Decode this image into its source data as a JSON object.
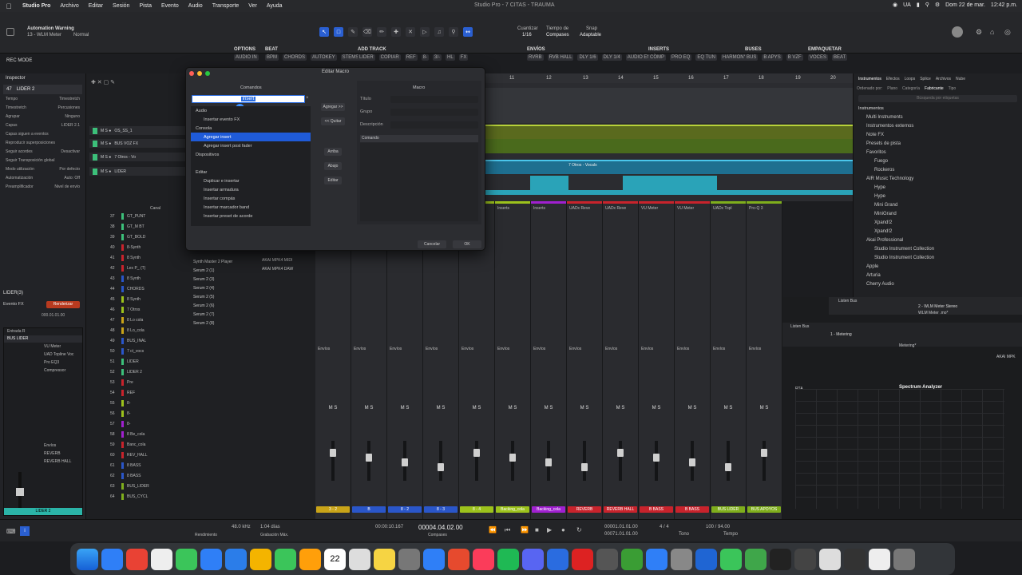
{
  "menubar": {
    "app": "Studio Pro",
    "items": [
      "Archivo",
      "Editar",
      "Sesión",
      "Pista",
      "Evento",
      "Audio",
      "Transporte",
      "Ver",
      "Ayuda"
    ],
    "window_title": "Studio Pro - 7 CITAS - TRAUMA",
    "lang": "UA",
    "date": "Dom 22 de mar.",
    "time": "12:42 p.m."
  },
  "toolbar": {
    "automation_label": "Automation Warning",
    "automation_sub": "13 - WLM Meter",
    "mode": "Normal",
    "rec_mode": "REC MODE",
    "groups": [
      {
        "title": "OPTIONS",
        "items": [
          "AUDIO IN"
        ]
      },
      {
        "title": "BEAT",
        "items": [
          "BPM",
          "CHORDS",
          "AUTOKEY",
          "STEMS"
        ]
      },
      {
        "title": "ADD TRACK",
        "items": [
          "LIDER",
          "COPIAR",
          "REF",
          "8-",
          "3/-",
          "HL",
          "FX"
        ]
      },
      {
        "title": "ENVÍOS",
        "items": [
          "RVRB",
          "RVB HALL",
          "DLY 1/6",
          "DLY 1/4",
          "AUDIO ENVÍO"
        ]
      },
      {
        "title": "INSERTS",
        "items": [
          "COMP",
          "PRO EQ",
          "EQ TUN",
          "HARMONY"
        ]
      },
      {
        "title": "BUSES",
        "items": [
          "BUS",
          "B APYS",
          "B VZF"
        ]
      },
      {
        "title": "EMPAQUETAR",
        "items": [
          "VOCES",
          "BEAT"
        ]
      }
    ],
    "quantize_label": "Cuantizar",
    "quantize_value": "1/16",
    "timebase_label": "Tiempo de",
    "timebase_value": "Compases",
    "snap_label": "Snap",
    "snap_value": "Adaptable"
  },
  "inspector": {
    "title": "Inspector",
    "track_num": "47",
    "track_name": "LIDER 2",
    "tempo_label": "Tempo",
    "tempo_value": "Timestretch",
    "timestretch_label": "Timestretch",
    "timestretch_value": "Percusiones",
    "group_label": "Agrupar",
    "group_value": "Ninguno",
    "layers_label": "Capas",
    "layers_value": "LIDER 2.1",
    "follow_label": "Capas siguen a eventos",
    "overdub_label": "Reproducir superposiciones",
    "chord_label": "Seguir acordes",
    "chord_value": "Desactivar",
    "transposition_label": "Seguir Transposición global",
    "delay_label": "Modo utilización",
    "delay_value": "Por defecto",
    "automation_label": "Automatización",
    "automation_value": "Auto: Off",
    "preamp_label": "Preamplificador",
    "preamp_value": "Nivel de envío",
    "sel_track": "LIDER(3)",
    "event_fx": "Evento FX",
    "render": "Renderizar",
    "pos": "000.01.01.00",
    "strip_label": "Entrada R",
    "bus_label": "BUS LIDER",
    "ins1": "VU Meter",
    "ins2": "UAD Topline Voc",
    "ins3": "Pro EQ3",
    "ins4": "Compressor",
    "send1": "Envíos",
    "send2": "REVERB",
    "send3": "REVERB HALL",
    "strip_name": "LIDER 2"
  },
  "tracks": [
    "OS_SS_1",
    "BUS VOZ FX",
    "7 Otros - Vo",
    "LIDER"
  ],
  "channel_list": {
    "header": "Canal",
    "rows": [
      [
        "37",
        "GT_PUNT"
      ],
      [
        "38",
        "GT_M BT"
      ],
      [
        "39",
        "GT_BOLD"
      ],
      [
        "40",
        "8-Synth"
      ],
      [
        "41",
        "8 Synth"
      ],
      [
        "42",
        "Lex P_ (T)"
      ],
      [
        "43",
        "8 Synth"
      ],
      [
        "44",
        "CHORDS"
      ],
      [
        "45",
        "8 Synth"
      ],
      [
        "46",
        "7 Otros"
      ],
      [
        "47",
        "8 Lo cola"
      ],
      [
        "48",
        "8 Lo_cola"
      ],
      [
        "49",
        "BUS_INAL"
      ],
      [
        "50",
        "7 ct_vocs"
      ],
      [
        "51",
        "LIDER"
      ],
      [
        "52",
        "LIDER 2"
      ],
      [
        "53",
        "Pre"
      ],
      [
        "54",
        "REF"
      ],
      [
        "55",
        "8-"
      ],
      [
        "56",
        "8-"
      ],
      [
        "57",
        "8-"
      ],
      [
        "58",
        "8 Be_cola"
      ],
      [
        "59",
        "Banc_cola"
      ],
      [
        "60",
        "REV_HALL"
      ],
      [
        "61",
        "8 BASS"
      ],
      [
        "62",
        "8 BASS"
      ],
      [
        "63",
        "BUS_LIDER"
      ],
      [
        "64",
        "BUS_CYCL"
      ]
    ]
  },
  "instruments": {
    "rows": [
      "Synth Master 2 Player",
      "Serum 2 (1)",
      "Serum 2 (3)",
      "Serum 2 (4)",
      "Serum 2 (5)",
      "Serum 2 (6)",
      "Serum 2 (7)",
      "Serum 2 (8)"
    ],
    "midi1": "AKAI MPK4 MIDI",
    "midi2": "AKAI MPK4 DAW"
  },
  "dialog": {
    "title": "Editar Macro",
    "commands_header": "Comandos",
    "search_value": "insert",
    "commands": [
      {
        "label": "Audio",
        "level": 0,
        "sel": false
      },
      {
        "label": "Insertar evento FX",
        "level": 1,
        "sel": false
      },
      {
        "label": "Consola",
        "level": 0,
        "sel": false
      },
      {
        "label": "Agregar insert",
        "level": 1,
        "sel": true
      },
      {
        "label": "Agregar insert post fader",
        "level": 1,
        "sel": false
      },
      {
        "label": "Dispositivos",
        "level": 0,
        "sel": false
      },
      {
        "label": "",
        "level": 1,
        "sel": false
      },
      {
        "label": "Editar",
        "level": 0,
        "sel": false
      },
      {
        "label": "Duplicar e insertar",
        "level": 1,
        "sel": false
      },
      {
        "label": "Insertar armadura",
        "level": 1,
        "sel": false
      },
      {
        "label": "Insertar compás",
        "level": 1,
        "sel": false
      },
      {
        "label": "Insertar marcador band",
        "level": 1,
        "sel": false
      },
      {
        "label": "Insertar preset de acorde",
        "level": 1,
        "sel": false
      }
    ],
    "add_btn": "Agregar >>",
    "remove_btn": "<< Quitar",
    "up_btn": "Arriba",
    "down_btn": "Abajo",
    "edit_btn": "Editar",
    "macro_header": "Macro",
    "title_label": "Título",
    "group_label": "Grupo",
    "desc_label": "Descripción",
    "command_col": "Comando",
    "cancel": "Cancelar",
    "ok": "OK"
  },
  "arrange": {
    "ruler": [
      "11",
      "12",
      "13",
      "14",
      "15",
      "16",
      "17",
      "18",
      "19",
      "20"
    ],
    "clip1": "7 Otros - Vocals"
  },
  "browser": {
    "tabs": [
      "Instrumentos",
      "Efectos",
      "Loops",
      "Splice",
      "Archivos",
      "Nube"
    ],
    "sort_label": "Ordenado por:",
    "sort_opts": [
      "Plano",
      "Categoría",
      "Fabricante",
      "Tipo"
    ],
    "search_placeholder": "Búsqueda por etiquetas",
    "header": "Instrumentos",
    "items": [
      {
        "label": "Multi Instruments",
        "level": 1
      },
      {
        "label": "Instrumentos externos",
        "level": 1
      },
      {
        "label": "Note FX",
        "level": 1
      },
      {
        "label": "Presets de pista",
        "level": 1
      },
      {
        "label": "Favoritos",
        "level": 1
      },
      {
        "label": "Fuego",
        "level": 2
      },
      {
        "label": "Rockeros",
        "level": 2
      },
      {
        "label": "AIR Music Technology",
        "level": 1
      },
      {
        "label": "Hype",
        "level": 2
      },
      {
        "label": "Hype",
        "level": 2
      },
      {
        "label": "Mini Grand",
        "level": 2
      },
      {
        "label": "MiniGrand",
        "level": 2
      },
      {
        "label": "Xpand!2",
        "level": 2
      },
      {
        "label": "Xpand!2",
        "level": 2
      },
      {
        "label": "Akai Professional",
        "level": 1
      },
      {
        "label": "Studio Instrument Collection",
        "level": 2
      },
      {
        "label": "Studio Instrument Collection",
        "level": 2
      },
      {
        "label": "Apple",
        "level": 1
      },
      {
        "label": "Arturia",
        "level": 1
      },
      {
        "label": "Cherry Audio",
        "level": 1
      }
    ]
  },
  "mixer": {
    "strips": [
      {
        "name": "3 - 2",
        "color": "#c9a418",
        "ins": ""
      },
      {
        "name": "B",
        "color": "#2a56c9",
        "ins": "VU Meter"
      },
      {
        "name": "8 - 2",
        "color": "#2a56c9",
        "ins": "VU Meter"
      },
      {
        "name": "8 - 3",
        "color": "#2a56c9",
        "ins": "VU Meter"
      },
      {
        "name": "8 - 4",
        "color": "#9cc21c",
        "ins": "Inserts"
      },
      {
        "name": "Backing_cola",
        "color": "#9cc21c",
        "ins": "Inserts"
      },
      {
        "name": "Backing_cola",
        "color": "#a020d0",
        "ins": "Inserts"
      },
      {
        "name": "REVERB",
        "color": "#c8232c",
        "ins": "UADx Reve"
      },
      {
        "name": "REVERB HALL",
        "color": "#c8232c",
        "ins": "UADx Reve"
      },
      {
        "name": "B BASS",
        "color": "#c8232c",
        "ins": "VU Meter"
      },
      {
        "name": "B BASS",
        "color": "#c8232c",
        "ins": "VU Meter"
      },
      {
        "name": "BUS LIDER",
        "color": "#7fae1c",
        "ins": "UADx Topl"
      },
      {
        "name": "BUS APOYOS",
        "color": "#7fae1c",
        "ins": "Pro-Q 3"
      }
    ],
    "sends_label": "Envíos",
    "stereo_label": "Estéreo"
  },
  "right": {
    "meter": "2 - WLM Meter Stereo",
    "meter2": "WLM Meter .mo*",
    "listen": "Listen Bus",
    "metering": "1 - Metering",
    "metering2": "Metering*",
    "spectrum": "Spectrum Analyzer",
    "rta": "RTA",
    "device": "AKAI MPK"
  },
  "transport": {
    "sr": "48.0 kHz",
    "time_rec": "1:04 días",
    "perf": "Rendimiento",
    "rec": "Grabación Máx.",
    "pos_time": "00:00:10.167",
    "pos_bars": "00004.04.02.00",
    "bars_label": "Compases",
    "loop_start": "00001.01.01.00",
    "loop_end": "00071.01.01.00",
    "sig": "4 / 4",
    "key": "Tono",
    "tempo": "100 / 94.00",
    "metro": "Tempo"
  },
  "dock": {
    "calendar_day": "22"
  }
}
